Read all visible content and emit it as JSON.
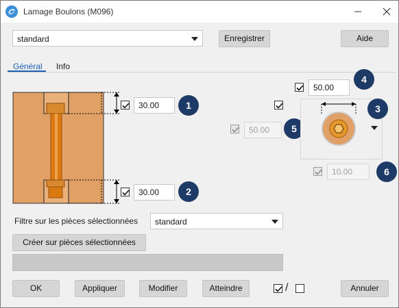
{
  "window": {
    "title": "Lamage Boulons (M096)"
  },
  "top": {
    "preset": "standard",
    "save_label": "Enregistrer",
    "help_label": "Aide"
  },
  "tabs": [
    {
      "label": "Général"
    },
    {
      "label": "Info"
    }
  ],
  "fields": {
    "top_depth": "30.00",
    "bottom_depth": "30.00",
    "diameter": "50.00",
    "offset": "50.00",
    "depth_extra": "10.00"
  },
  "badges": [
    "1",
    "2",
    "3",
    "4",
    "5",
    "6"
  ],
  "filter": {
    "label": "Filtre sur les pièces sélectionnées",
    "value": "standard"
  },
  "create_label": "Créer sur pièces sélectionnées",
  "footer": {
    "ok": "OK",
    "apply": "Appliquer",
    "modify": "Modifier",
    "reach": "Atteindre",
    "cancel": "Annuler",
    "toggle_separator": "/"
  },
  "colors": {
    "accent": "#1a5fb4",
    "badge": "#1e3a66",
    "part": "#e0a066",
    "bolt": "#d97a12"
  }
}
